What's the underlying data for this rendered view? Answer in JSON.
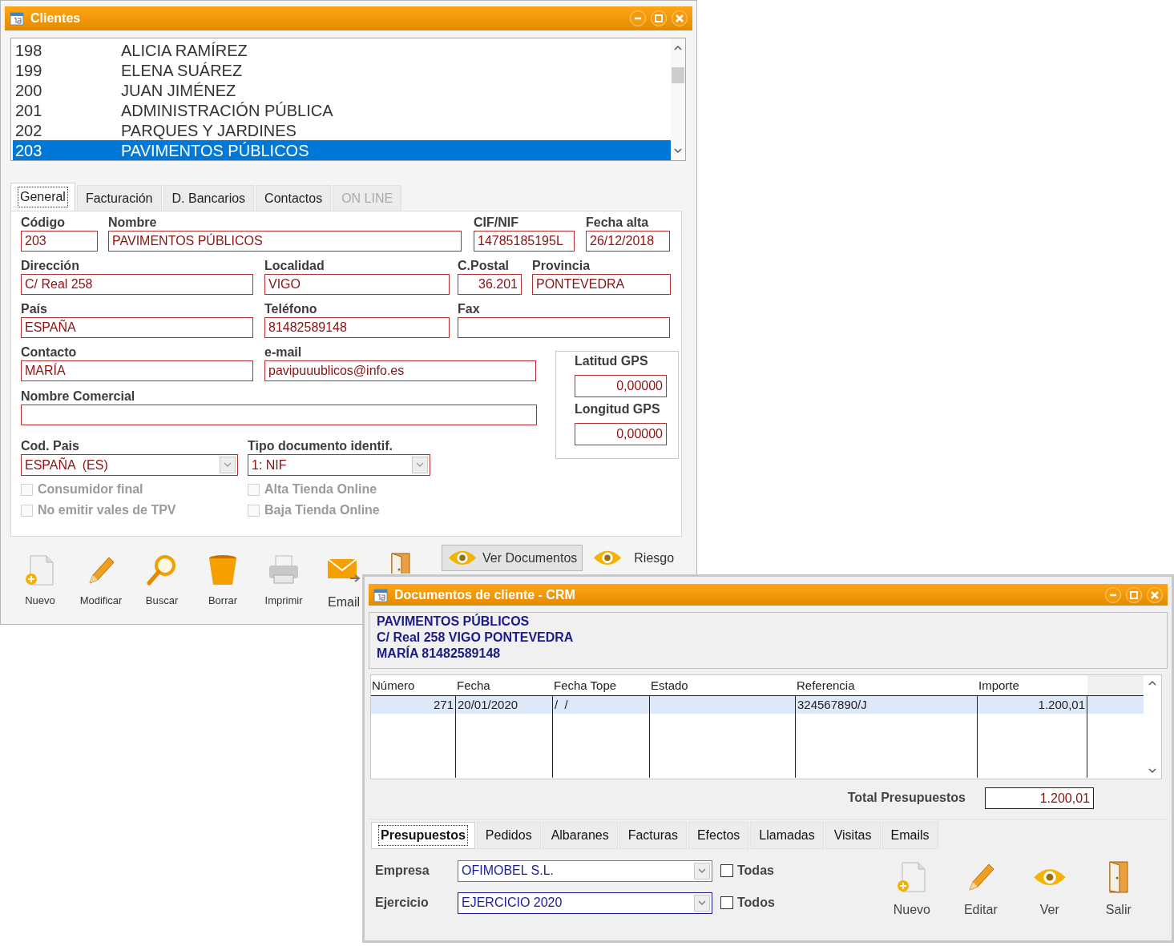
{
  "clients_window": {
    "title": "Clientes",
    "client_list": [
      {
        "code": "198",
        "name": "ALICIA RAMÍREZ",
        "selected": false
      },
      {
        "code": "199",
        "name": "ELENA SUÁREZ",
        "selected": false
      },
      {
        "code": "200",
        "name": "JUAN JIMÉNEZ",
        "selected": false
      },
      {
        "code": "201",
        "name": "ADMINISTRACIÓN PÚBLICA",
        "selected": false
      },
      {
        "code": "202",
        "name": "PARQUES Y JARDINES",
        "selected": false
      },
      {
        "code": "203",
        "name": "PAVIMENTOS PÚBLICOS",
        "selected": true
      }
    ],
    "tabs": [
      {
        "label": "General",
        "selected": true,
        "disabled": false
      },
      {
        "label": "Facturación",
        "selected": false,
        "disabled": false
      },
      {
        "label": "D. Bancarios",
        "selected": false,
        "disabled": false
      },
      {
        "label": "Contactos",
        "selected": false,
        "disabled": false
      },
      {
        "label": "ON LINE",
        "selected": false,
        "disabled": true
      }
    ],
    "field_rows": [
      [
        {
          "label": "Código",
          "value": "203"
        },
        {
          "label": "Nombre",
          "value": "PAVIMENTOS PÚBLICOS"
        },
        {
          "label": "CIF/NIF",
          "value": "14785185195L"
        },
        {
          "label": "Fecha alta",
          "value": "26/12/2018"
        }
      ],
      [
        {
          "label": "Dirección",
          "value": "C/ Real 258"
        },
        {
          "label": "Localidad",
          "value": "VIGO"
        },
        {
          "label": "C.Postal",
          "value": "36.201"
        },
        {
          "label": "Provincia",
          "value": "PONTEVEDRA"
        }
      ],
      [
        {
          "label": "País",
          "value": "ESPAÑA"
        },
        {
          "label": "Teléfono",
          "value": "81482589148"
        },
        {
          "label": "Fax"
        }
      ],
      [
        {
          "label": "Contacto",
          "value": "MARÍA"
        },
        {
          "label": "e-mail",
          "value": "pavipuuublicos@info.es"
        }
      ],
      [
        {
          "label": "Nombre Comercial"
        }
      ]
    ],
    "gps": [
      {
        "label": "Latitud GPS",
        "value": "0,00000"
      },
      {
        "label": "Longitud GPS",
        "value": "0,00000"
      }
    ],
    "dropdowns": [
      {
        "label": "Cod. Pais",
        "value": "ESPAÑA  (ES)"
      },
      {
        "label": "Tipo documento identif.",
        "value": "1: NIF"
      }
    ],
    "checkboxes": [
      {
        "label": "Consumidor final",
        "checked": false,
        "disabled": true
      },
      {
        "label": "Alta Tienda Online",
        "checked": false,
        "disabled": true
      },
      {
        "label": "No emitir vales de TPV",
        "checked": false,
        "disabled": true
      },
      {
        "label": "Baja Tienda Online",
        "checked": false,
        "disabled": true
      }
    ],
    "toolbar": [
      {
        "label": "Nuevo",
        "kind": "new"
      },
      {
        "label": "Modificar",
        "kind": "edit"
      },
      {
        "label": "Buscar",
        "kind": "search"
      },
      {
        "label": "Borrar",
        "kind": "delete"
      },
      {
        "label": "Imprimir",
        "kind": "print"
      },
      {
        "label": "Email",
        "kind": "email"
      },
      {
        "kind": "exit"
      }
    ],
    "ver_documentos": "Ver Documentos",
    "riesgo": "Riesgo"
  },
  "documents_window": {
    "title": "Documentos de cliente - CRM",
    "header_lines": [
      "PAVIMENTOS PÚBLICOS",
      "C/ Real 258 VIGO PONTEVEDRA",
      "MARÍA 81482589148"
    ],
    "table": {
      "columns": [
        "Número",
        "Fecha",
        "Fecha Tope",
        "Estado",
        "Referencia",
        "Importe"
      ],
      "rows": [
        {
          "numero": "271",
          "fecha": "20/01/2020",
          "fecha_tope": "/  /",
          "referencia": "324567890/J",
          "importe": "1.200,01",
          "selected": true
        }
      ]
    },
    "total": {
      "label": "Total Presupuestos",
      "value": "1.200,01"
    },
    "tabs": [
      {
        "label": "Presupuestos",
        "selected": true
      },
      {
        "label": "Pedidos",
        "selected": false
      },
      {
        "label": "Albaranes",
        "selected": false
      },
      {
        "label": "Facturas",
        "selected": false
      },
      {
        "label": "Efectos",
        "selected": false
      },
      {
        "label": "Llamadas",
        "selected": false
      },
      {
        "label": "Visitas",
        "selected": false
      },
      {
        "label": "Emails",
        "selected": false
      }
    ],
    "filters": [
      {
        "label": "Empresa",
        "value": "OFIMOBEL S.L.",
        "focused": false,
        "option": {
          "label": "Todas",
          "checked": false
        }
      },
      {
        "label": "Ejercicio",
        "value": "EJERCICIO 2020",
        "focused": true,
        "option": {
          "label": "Todos",
          "checked": false
        }
      }
    ],
    "actions": [
      {
        "label": "Nuevo",
        "kind": "new"
      },
      {
        "label": "Editar",
        "kind": "edit"
      },
      {
        "label": "Ver",
        "kind": "view"
      },
      {
        "label": "Salir",
        "kind": "exit"
      }
    ]
  }
}
